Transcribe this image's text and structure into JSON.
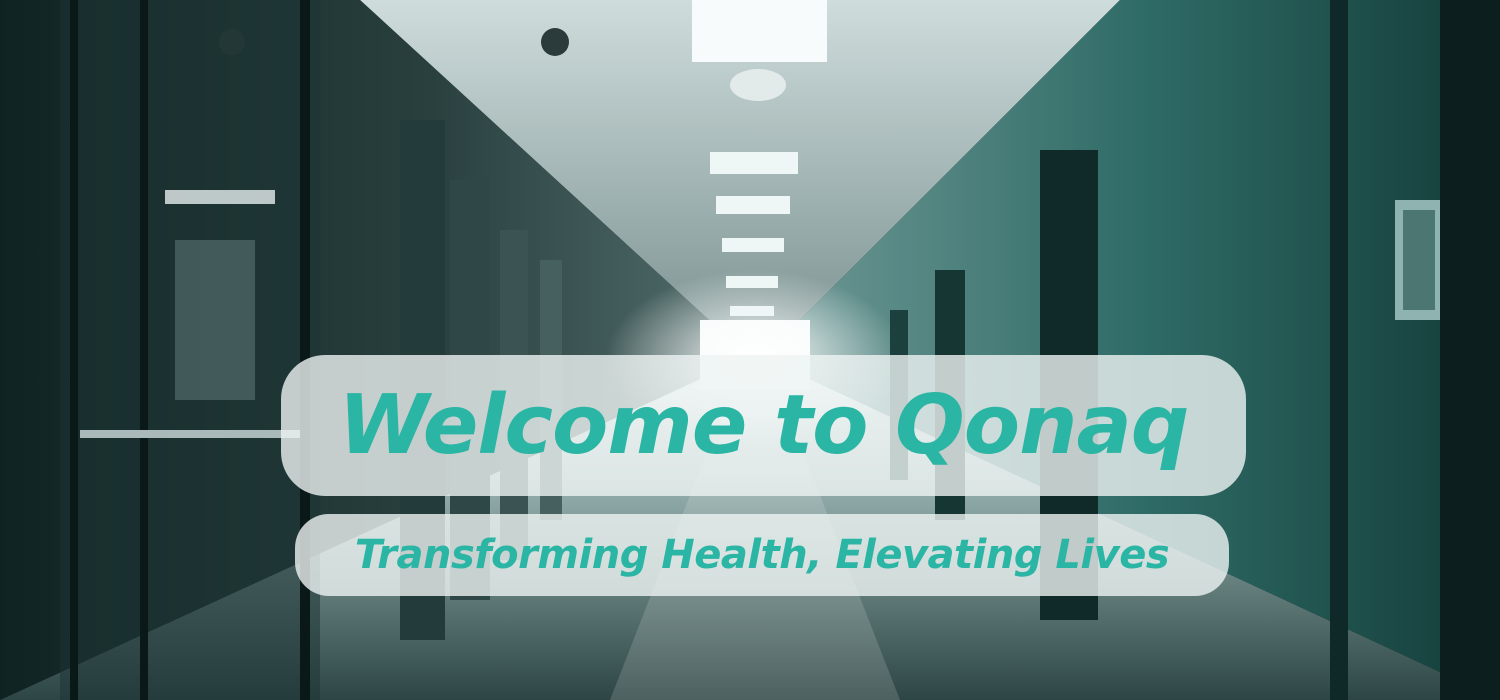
{
  "hero": {
    "title": "Welcome to Qonaq",
    "subtitle": "Transforming Health, Elevating Lives",
    "background": "hospital-corridor-photo"
  },
  "colors": {
    "accent": "#2bb5a4",
    "pill_bg": "#eef4f3",
    "wall_teal": "#2f6b66",
    "dark": "#0d1d1e"
  }
}
